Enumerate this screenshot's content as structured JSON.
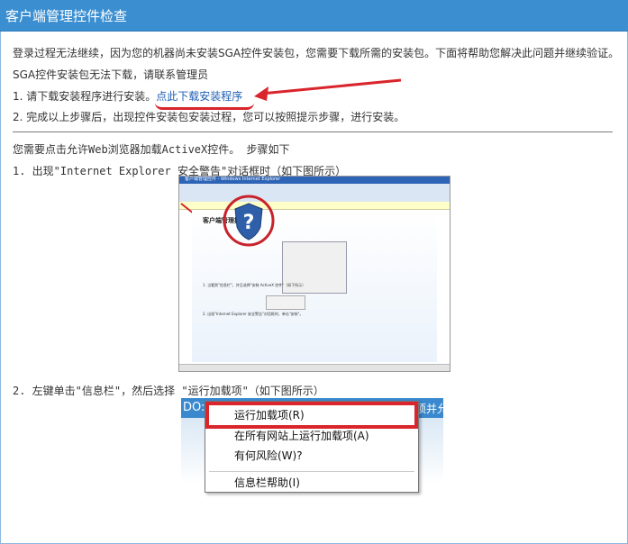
{
  "header": {
    "title": "客户端管理控件检查"
  },
  "intro": {
    "line1": "登录过程无法继续，因为您的机器尚未安装SGA控件安装包，您需要下载所需的安装包。下面将帮助您解决此问题并继续验证。",
    "line2": "SGA控件安装包无法下载，请联系管理员"
  },
  "steps": {
    "step1_prefix": "1. 请下载安装程序进行安装。",
    "step1_link": "点此下载安装程序",
    "step2": "2. 完成以上步骤后，出现控件安装包安装过程，您可以按照提示步骤，进行安装。"
  },
  "activex": {
    "heading": "您需要点击允许Web浏览器加载ActiveX控件。 步骤如下",
    "step1": "1. 出现\"Internet Explorer 安全警告\"对话框时（如下图所示）",
    "step2": "2. 左键单击\"信息栏\"，然后选择 \"运行加载项\"（如下图所示）"
  },
  "screenshot1": {
    "window_title": "客户端管理控件 - Windows Internet Explorer",
    "page_heading": "客户端管理控件安装",
    "step_note_1": "1. 当看到\"信息栏\"，并且选择\"安装 ActiveX 控件\"（如下所示）",
    "step_note_2": "2. 出现\"Internet Explorer 安全警告\"对话框时，单击\"安装\"。"
  },
  "screenshot2": {
    "bar_left": "DO:",
    "bar_right": "项并允",
    "menu": [
      "运行加载项(R)",
      "在所有网站上运行加载项(A)",
      "有何风险(W)?",
      "信息栏帮助(I)"
    ]
  }
}
